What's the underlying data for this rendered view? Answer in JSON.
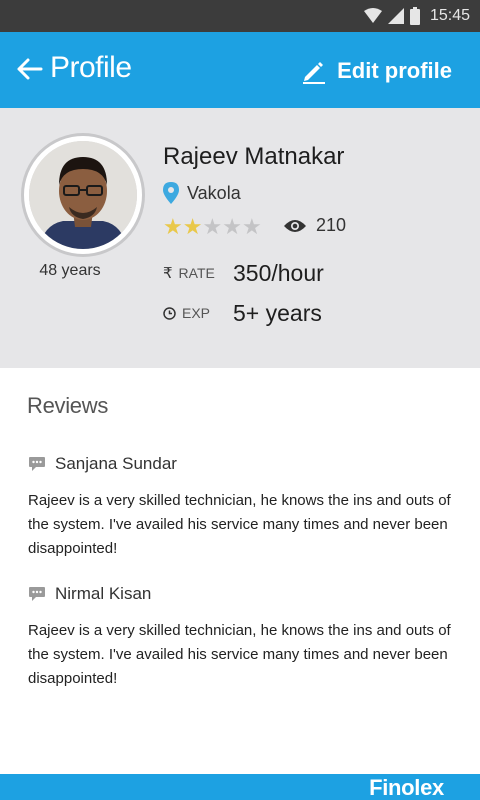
{
  "status_bar": {
    "time": "15:45",
    "icons": [
      "wifi-icon",
      "signal-icon",
      "battery-icon"
    ]
  },
  "app_bar": {
    "title": "Profile",
    "edit_label": "Edit profile",
    "back_icon": "arrow-left-icon",
    "edit_icon": "pencil-icon"
  },
  "profile": {
    "name": "Rajeev Matnakar",
    "location": "Vakola",
    "age": "48 years",
    "rating": 2,
    "rating_max": 5,
    "views": "210",
    "rate_label": "RATE",
    "rate_value": "350/hour",
    "exp_label": "EXP",
    "exp_value": "5+ years"
  },
  "reviews": {
    "title": "Reviews",
    "items": [
      {
        "author": "Sanjana Sundar",
        "text": "Rajeev is a very skilled technician, he knows the ins  and outs of the system.  I've availed his service  many times and never been disappointed!"
      },
      {
        "author": "Nirmal Kisan",
        "text": "Rajeev is a very skilled technician, he knows the ins  and outs of the system.  I've availed his service  many times and never been disappointed!"
      }
    ]
  },
  "footer": {
    "brand": "Finolex"
  },
  "colors": {
    "primary": "#1da1e2",
    "panel": "#e6e6e8",
    "star": "#e9c84a",
    "pin": "#3da9e0"
  }
}
